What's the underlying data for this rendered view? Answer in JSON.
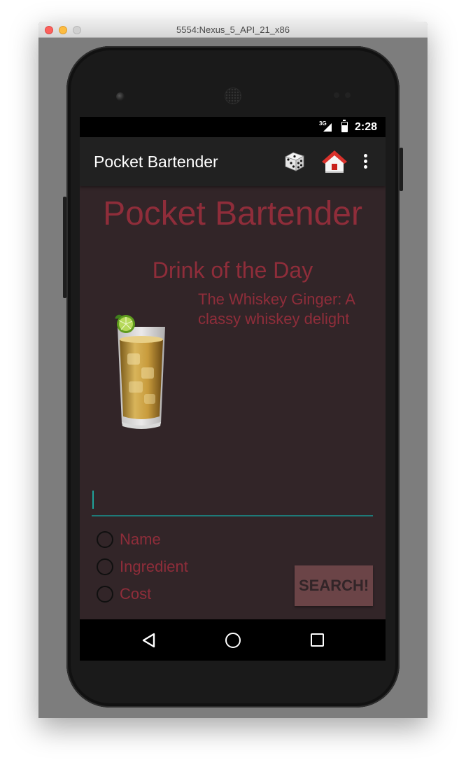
{
  "window": {
    "title": "5554:Nexus_5_API_21_x86"
  },
  "statusbar": {
    "network": "3G",
    "time": "2:28"
  },
  "appbar": {
    "title": "Pocket Bartender",
    "icons": [
      "dice-icon",
      "home-icon",
      "overflow-menu-icon"
    ]
  },
  "main": {
    "heading": "Pocket Bartender",
    "drink_of_day_title": "Drink of the Day",
    "drink_description": "The Whiskey Ginger: A classy whiskey delight",
    "search_value": "",
    "search_options": [
      {
        "label": "Name",
        "selected": false
      },
      {
        "label": "Ingredient",
        "selected": false
      },
      {
        "label": "Cost",
        "selected": false
      }
    ],
    "search_button_label": "SEARCH!"
  },
  "colors": {
    "background": "#322528",
    "accent_text": "#8f2d3a",
    "input_underline": "#1e7a78",
    "button": "#6b4447"
  }
}
